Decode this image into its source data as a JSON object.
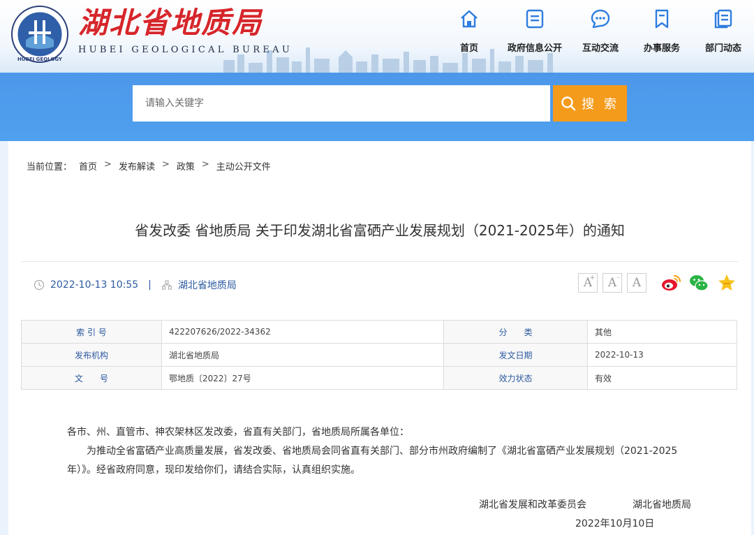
{
  "header": {
    "title": "湖北省地质局",
    "subtitle": "HUBEI GEOLOGICAL BUREAU",
    "logo_text": "HUBEI GEOLOGY"
  },
  "nav": [
    {
      "label": "首页",
      "icon": "home-icon"
    },
    {
      "label": "政府信息公开",
      "icon": "document-list-icon"
    },
    {
      "label": "互动交流",
      "icon": "chat-bubble-icon"
    },
    {
      "label": "办事服务",
      "icon": "bookmark-icon"
    },
    {
      "label": "部门动态",
      "icon": "news-icon"
    }
  ],
  "search": {
    "placeholder": "请输入关键字",
    "button_label": "搜 索"
  },
  "breadcrumb": {
    "prefix": "当前位置：",
    "items": [
      "首页",
      "发布解读",
      "政策",
      "主动公开文件"
    ],
    "separator": ">"
  },
  "article": {
    "title": "省发改委 省地质局 关于印发湖北省富硒产业发展规划（2021-2025年）的通知",
    "datetime": "2022-10-13 10:55",
    "source": "湖北省地质局"
  },
  "toolbar": {
    "font_large": "A",
    "font_medium": "A",
    "font_small": "A"
  },
  "info_table": [
    {
      "k1": "索 引 号",
      "v1": "422207626/2022-34362",
      "k2": "分　　类",
      "v2": "其他"
    },
    {
      "k1": "发布机构",
      "v1": "湖北省地质局",
      "k2": "发文日期",
      "v2": "2022-10-13"
    },
    {
      "k1": "文　　号",
      "v1": "鄂地质〔2022〕27号",
      "k2": "效力状态",
      "v2": "有效"
    }
  ],
  "body": {
    "salutation": "各市、州、直管市、神农架林区发改委，省直有关部门，省地质局所属各单位：",
    "paragraph": "为推动全省富硒产业高质量发展，省发改委、省地质局会同省直有关部门、部分市州政府编制了《湖北省富硒产业发展规划（2021-2025年）》。经省政府同意，现印发给你们，请结合实际，认真组织实施。",
    "signer1": "湖北省发展和改革委员会",
    "signer2": "湖北省地质局",
    "date": "2022年10月10日"
  },
  "colors": {
    "brand_red": "#d6262b",
    "band_blue": "#4d97ea",
    "search_orange": "#f59b1c",
    "link_blue": "#2c5aa0"
  }
}
